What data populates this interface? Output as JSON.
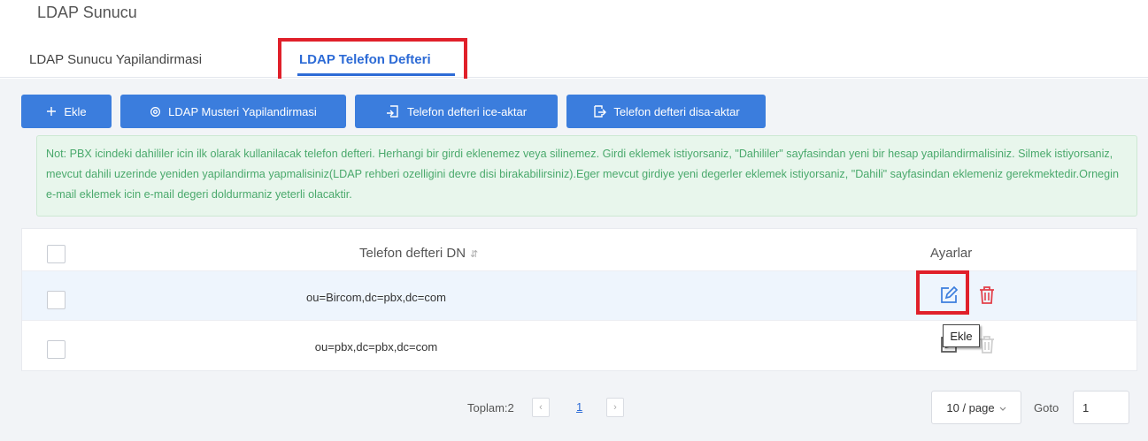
{
  "page": {
    "title": "LDAP Sunucu"
  },
  "tabs": [
    {
      "label": "LDAP Sunucu Yapilandirmasi",
      "active": false
    },
    {
      "label": "LDAP Telefon Defteri",
      "active": true
    }
  ],
  "toolbar": {
    "add_label": "Ekle",
    "ldap_client_label": "LDAP Musteri Yapilandirmasi",
    "import_label": "Telefon defteri ice-aktar",
    "export_label": "Telefon defteri disa-aktar"
  },
  "note": "Not: PBX icindeki dahililer icin ilk olarak kullanilacak telefon defteri. Herhangi bir girdi eklenemez veya silinemez. Girdi eklemek istiyorsaniz, \"Dahililer\" sayfasindan yeni bir hesap yapilandirmalisiniz. Silmek istiyorsaniz, mevcut dahili uzerinde yeniden yapilandirma yapmalisiniz(LDAP rehberi ozelligini devre disi birakabilirsiniz).Eger mevcut girdiye yeni degerler eklemek istiyorsaniz, \"Dahili\" sayfasindan eklemeniz gerekmektedir.Ornegin e-mail eklemek icin e-mail degeri doldurmaniz yeterli olacaktir.",
  "table": {
    "columns": {
      "dn": "Telefon defteri DN",
      "settings": "Ayarlar"
    },
    "rows": [
      {
        "dn": "ou=Bircom,dc=pbx,dc=com"
      },
      {
        "dn": "ou=pbx,dc=pbx,dc=com"
      }
    ]
  },
  "tooltip": "Ekle",
  "pagination": {
    "total": "Toplam:2",
    "current_page": "1",
    "page_size": "10 / page",
    "goto_label": "Goto",
    "goto_value": "1"
  },
  "colors": {
    "primary": "#3b7ddd",
    "highlight": "#e0202a",
    "note_text": "#4aa96c",
    "delete": "#e2404a"
  },
  "icons": [
    "plus-icon",
    "settings-icon",
    "import-icon",
    "export-icon",
    "sort-icon",
    "edit-icon",
    "trash-icon",
    "chevron-left-icon",
    "chevron-right-icon",
    "chevron-down-icon"
  ]
}
